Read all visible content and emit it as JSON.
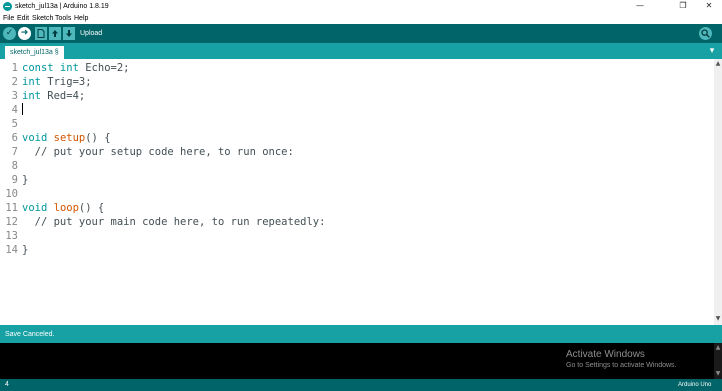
{
  "window": {
    "title": "sketch_jul13a | Arduino 1.8.19",
    "controls": {
      "minimize": "—",
      "maximize": "❐",
      "close": "✕"
    }
  },
  "menu": {
    "items": [
      {
        "label": "File"
      },
      {
        "label": "Edit"
      },
      {
        "label": "Sketch"
      },
      {
        "label": "Tools"
      },
      {
        "label": "Help"
      }
    ]
  },
  "toolbar": {
    "verify_icon": "✓",
    "upload_icon": "➜",
    "hover_label": "Upload"
  },
  "tabs": [
    {
      "label": "sketch_jul13a §"
    }
  ],
  "tab_menu_icon": "▾",
  "editor": {
    "lines": [
      {
        "num": "1",
        "parts": [
          {
            "t": "const int",
            "c": "kw"
          },
          {
            "t": " Echo=2;",
            "c": ""
          }
        ]
      },
      {
        "num": "2",
        "parts": [
          {
            "t": "int",
            "c": "kw"
          },
          {
            "t": " Trig=3;",
            "c": ""
          }
        ]
      },
      {
        "num": "3",
        "parts": [
          {
            "t": "int",
            "c": "kw"
          },
          {
            "t": " Red=4;",
            "c": ""
          }
        ]
      },
      {
        "num": "4",
        "parts": []
      },
      {
        "num": "5",
        "parts": []
      },
      {
        "num": "6",
        "parts": [
          {
            "t": "void",
            "c": "kw"
          },
          {
            "t": " ",
            "c": ""
          },
          {
            "t": "setup",
            "c": "fn"
          },
          {
            "t": "() {",
            "c": ""
          }
        ]
      },
      {
        "num": "7",
        "parts": [
          {
            "t": "  // put your setup code here, to run once:",
            "c": "cm"
          }
        ]
      },
      {
        "num": "8",
        "parts": []
      },
      {
        "num": "9",
        "parts": [
          {
            "t": "}",
            "c": ""
          }
        ]
      },
      {
        "num": "10",
        "parts": []
      },
      {
        "num": "11",
        "parts": [
          {
            "t": "void",
            "c": "kw"
          },
          {
            "t": " ",
            "c": ""
          },
          {
            "t": "loop",
            "c": "fn"
          },
          {
            "t": "() {",
            "c": ""
          }
        ]
      },
      {
        "num": "12",
        "parts": [
          {
            "t": "  // put your main code here, to run repeatedly:",
            "c": "cm"
          }
        ]
      },
      {
        "num": "13",
        "parts": []
      },
      {
        "num": "14",
        "parts": [
          {
            "t": "}",
            "c": ""
          }
        ]
      }
    ]
  },
  "status": {
    "message": "Save Canceled."
  },
  "watermark": {
    "title": "Activate Windows",
    "subtitle": "Go to Settings to activate Windows."
  },
  "footer": {
    "line_number": "4",
    "board": "Arduino Uno"
  },
  "colors": {
    "toolbar": "#006468",
    "tabbar": "#17a1a5",
    "keyword": "#00979c",
    "function": "#d35400"
  }
}
